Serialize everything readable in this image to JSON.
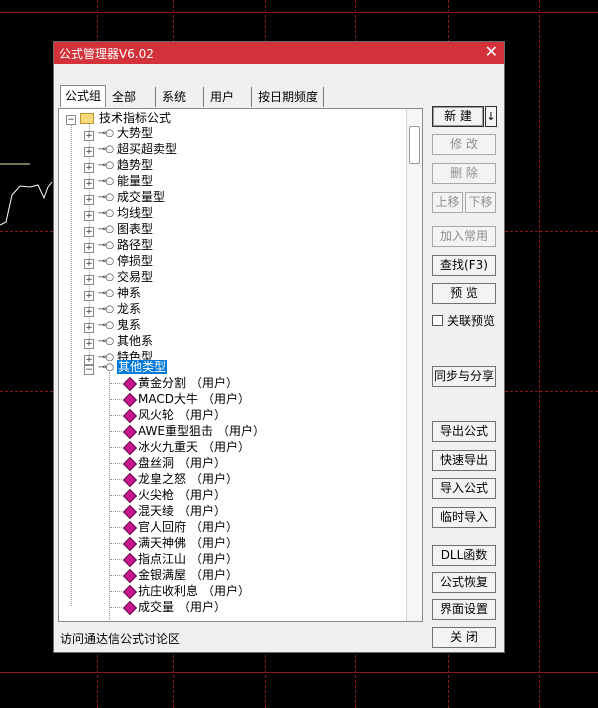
{
  "dialog": {
    "title": "公式管理器V6.02",
    "close_glyph": "✕"
  },
  "tabs": [
    {
      "label": "公式组",
      "active": true
    },
    {
      "label": "全部",
      "active": false
    },
    {
      "label": "系统",
      "active": false
    },
    {
      "label": "用户",
      "active": false
    },
    {
      "label": "按日期频度",
      "active": false
    }
  ],
  "tree": {
    "root": "技术指标公式",
    "groups": [
      "大势型",
      "超买超卖型",
      "趋势型",
      "能量型",
      "成交量型",
      "均线型",
      "图表型",
      "路径型",
      "停损型",
      "交易型",
      "神系",
      "龙系",
      "鬼系",
      "其他系",
      "特色型"
    ],
    "expanded_group": "其他类型",
    "user_tag": "（用户）",
    "formulas": [
      "黄金分割",
      "MACD大牛",
      "风火轮",
      "AWE重型狙击",
      "冰火九重天",
      "盘丝洞",
      "龙皇之怒",
      "火尖枪",
      "混天绫",
      "官人回府",
      "满天神佛",
      "指点江山",
      "金银满屋",
      "抗庄收利息",
      "成交量"
    ]
  },
  "buttons": {
    "new": "新 建",
    "new_arrow": "↓",
    "edit": "修 改",
    "delete": "删 除",
    "move_up": "上移",
    "move_down": "下移",
    "add_common": "加入常用",
    "find": "查找(F3)",
    "preview": "预 览",
    "linked_preview": "关联预览",
    "sync_share": "同步与分享",
    "export": "导出公式",
    "quick_export": "快速导出",
    "import": "导入公式",
    "temp_import": "临时导入",
    "dll": "DLL函数",
    "restore": "公式恢复",
    "ui_settings": "界面设置",
    "close": "关 闭"
  },
  "footer_link": "访问通达信公式讨论区",
  "colors": {
    "titlebar": "#d4323b",
    "selection": "#0078d7",
    "formula_icon": "#c8168a",
    "background": "#000000",
    "grid": "#8a1a1a"
  }
}
